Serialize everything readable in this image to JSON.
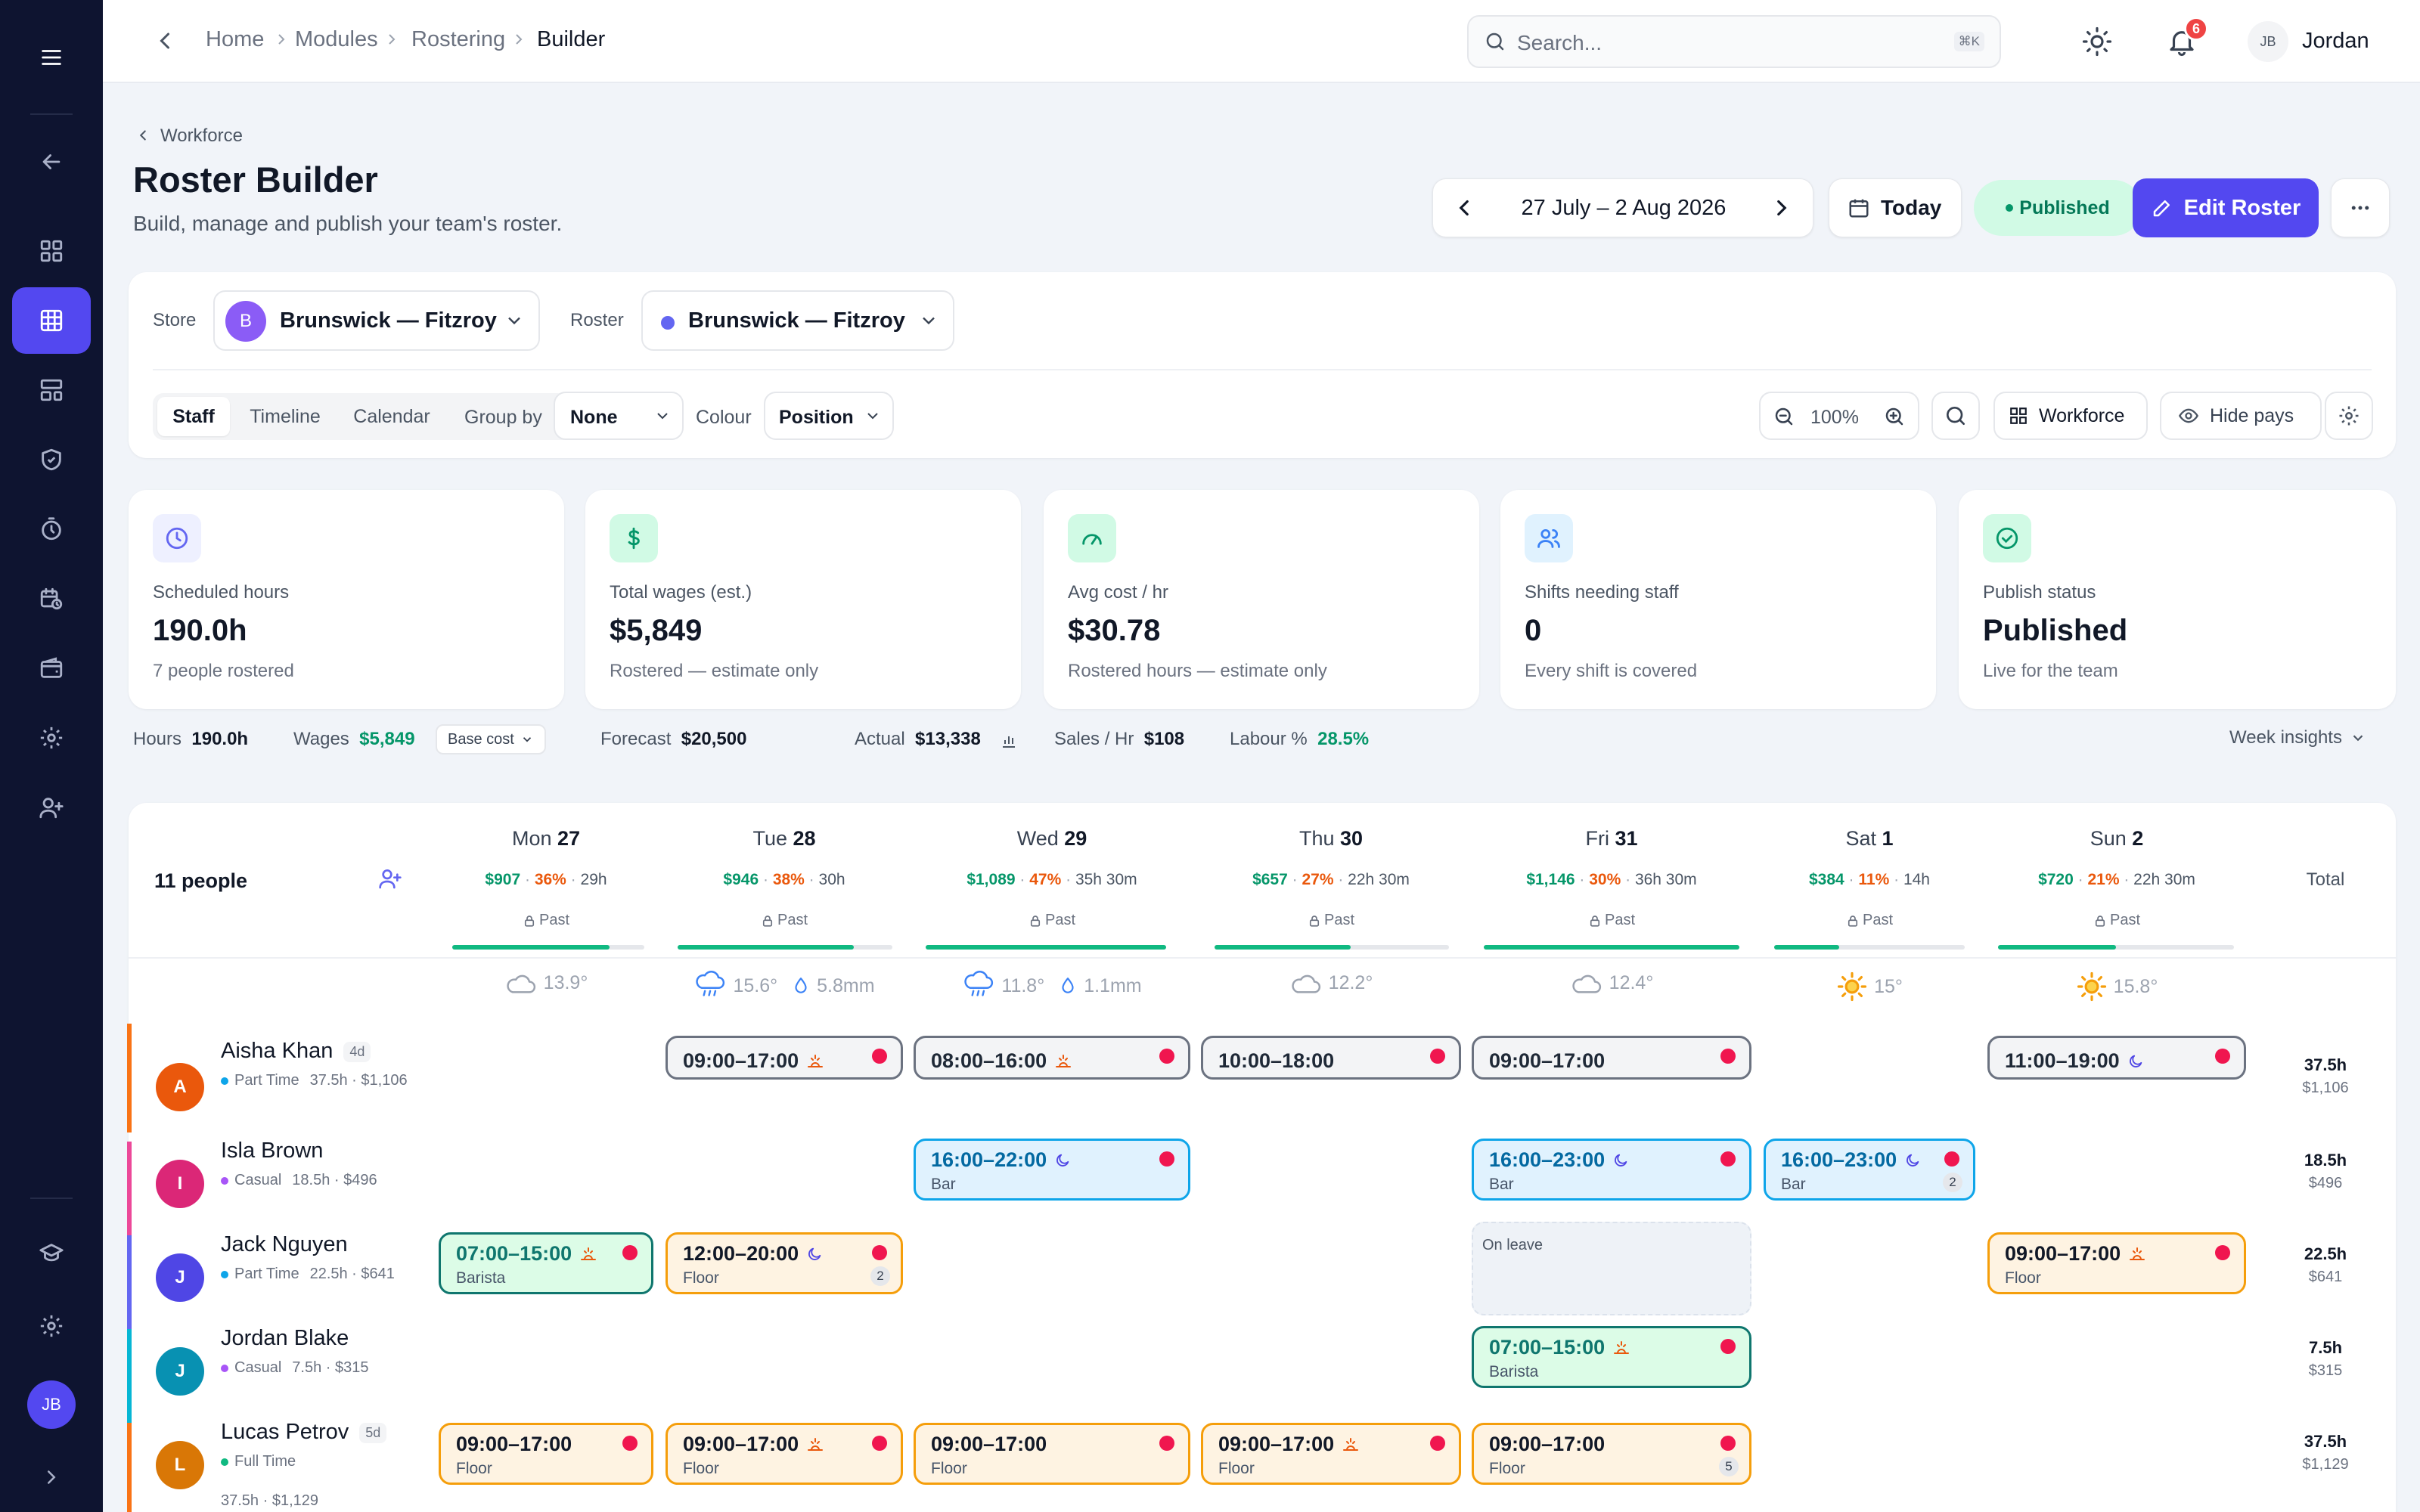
{
  "topbar": {
    "crumbs": [
      "Home",
      "Modules",
      "Rostering",
      "Builder"
    ],
    "search_placeholder": "Search...",
    "search_kbd": "⌘K",
    "notif_count": "6",
    "user_initials": "JB",
    "user_name": "Jordan"
  },
  "sidebar": {
    "user_initials": "JB",
    "icons": [
      "menu-icon",
      "back-arrow-icon",
      "dashboard-icon",
      "roster-grid-icon",
      "layout-icon",
      "shield-icon",
      "timer-icon",
      "calendar-clock-icon",
      "wallet-icon",
      "gear-icon",
      "user-plus-icon",
      "graduation-cap-icon",
      "gear-icon",
      "chevron-right-icon"
    ]
  },
  "header": {
    "back_label": "Workforce",
    "title": "Roster Builder",
    "subtitle": "Build, manage and publish your team's roster.",
    "date_range": "27 July – 2 Aug 2026",
    "today": "Today",
    "status": "Published",
    "edit": "Edit Roster"
  },
  "filters": {
    "store_label": "Store",
    "store_initial": "B",
    "store_name": "Brunswick — Fitzroy",
    "roster_label": "Roster",
    "roster_name": "Brunswick — Fitzroy",
    "views": [
      "Staff",
      "Timeline",
      "Calendar"
    ],
    "group_label": "Group by",
    "group_value": "None",
    "colour_label": "Colour",
    "colour_value": "Position",
    "zoom": "100%",
    "workforce": "Workforce",
    "hide_pays": "Hide pays"
  },
  "stats": [
    {
      "label": "Scheduled hours",
      "value": "190.0h",
      "sub": "7 people rostered",
      "color": "#6366f1",
      "bg": "#eef0ff"
    },
    {
      "label": "Total wages (est.)",
      "value": "$5,849",
      "sub": "Rostered — estimate only",
      "color": "#059669",
      "bg": "#d1fae5"
    },
    {
      "label": "Avg cost / hr",
      "value": "$30.78",
      "sub": "Rostered hours — estimate only",
      "color": "#059669",
      "bg": "#d1fae5"
    },
    {
      "label": "Shifts needing staff",
      "value": "0",
      "sub": "Every shift is covered",
      "color": "#3b82f6",
      "bg": "#e0f2fe"
    },
    {
      "label": "Publish status",
      "value": "Published",
      "sub": "Live for the team",
      "color": "#059669",
      "bg": "#d1fae5"
    }
  ],
  "insights": {
    "hours_label": "Hours",
    "hours": "190.0h",
    "wages_label": "Wages",
    "wages": "$5,849",
    "base_cost": "Base cost",
    "forecast_label": "Forecast",
    "forecast": "$20,500",
    "actual_label": "Actual",
    "actual": "$13,338",
    "sales_label": "Sales / Hr",
    "sales": "$108",
    "labour_label": "Labour %",
    "labour": "28.5%",
    "week": "Week insights"
  },
  "grid": {
    "people": "11 people",
    "total_label": "Total",
    "past_label": "Past",
    "days": [
      {
        "dow": "Mon",
        "date": "27",
        "cost": "$907",
        "pct": "36%",
        "hrs": "29h",
        "progress": 0.82,
        "weather": "cloud",
        "temp": "13.9°",
        "rain": ""
      },
      {
        "dow": "Tue",
        "date": "28",
        "cost": "$946",
        "pct": "38%",
        "hrs": "30h",
        "progress": 0.82,
        "weather": "rain",
        "temp": "15.6°",
        "rain": "5.8mm"
      },
      {
        "dow": "Wed",
        "date": "29",
        "cost": "$1,089",
        "pct": "47%",
        "hrs": "35h 30m",
        "progress": 1.0,
        "weather": "rain",
        "temp": "11.8°",
        "rain": "1.1mm"
      },
      {
        "dow": "Thu",
        "date": "30",
        "cost": "$657",
        "pct": "27%",
        "hrs": "22h 30m",
        "progress": 0.58,
        "weather": "cloud",
        "temp": "12.2°",
        "rain": ""
      },
      {
        "dow": "Fri",
        "date": "31",
        "cost": "$1,146",
        "pct": "30%",
        "hrs": "36h 30m",
        "progress": 1.0,
        "weather": "cloud",
        "temp": "12.4°",
        "rain": ""
      },
      {
        "dow": "Sat",
        "date": "1",
        "cost": "$384",
        "pct": "11%",
        "hrs": "14h",
        "progress": 0.34,
        "weather": "sun",
        "temp": "15°",
        "rain": ""
      },
      {
        "dow": "Sun",
        "date": "2",
        "cost": "$720",
        "pct": "21%",
        "hrs": "22h 30m",
        "progress": 0.5,
        "weather": "sun",
        "temp": "15.8°",
        "rain": ""
      }
    ],
    "employees": [
      {
        "initial": "A",
        "name": "Aisha Khan",
        "tag": "4d",
        "type": "Part Time",
        "typecolor": "#0ea5e9",
        "meta1": "37.5h · $1,106",
        "meta2": "",
        "avatar": "#ea580c",
        "bar": "#f97316",
        "total": "37.5h",
        "total_sub": "$1,106",
        "shifts": [
          {
            "day": 1,
            "time": "09:00–17:00",
            "role": "",
            "style": "grey",
            "icon": "sun",
            "count": ""
          },
          {
            "day": 2,
            "time": "08:00–16:00",
            "role": "",
            "style": "grey",
            "icon": "sun",
            "count": ""
          },
          {
            "day": 3,
            "time": "10:00–18:00",
            "role": "",
            "style": "grey",
            "icon": "",
            "count": ""
          },
          {
            "day": 4,
            "time": "09:00–17:00",
            "role": "",
            "style": "grey",
            "icon": "",
            "count": ""
          },
          {
            "day": 6,
            "time": "11:00–19:00",
            "role": "",
            "style": "grey",
            "icon": "moon",
            "count": ""
          }
        ]
      },
      {
        "initial": "I",
        "name": "Isla Brown",
        "tag": "",
        "type": "Casual",
        "typecolor": "#a855f7",
        "meta1": "18.5h · $496",
        "meta2": "",
        "avatar": "#db2777",
        "bar": "#ec4899",
        "total": "18.5h",
        "total_sub": "$496",
        "shifts": [
          {
            "day": 2,
            "time": "16:00–22:00",
            "role": "Bar",
            "style": "blue",
            "icon": "moon",
            "count": ""
          },
          {
            "day": 4,
            "time": "16:00–23:00",
            "role": "Bar",
            "style": "blue",
            "icon": "moon",
            "count": ""
          },
          {
            "day": 5,
            "time": "16:00–23:00",
            "role": "Bar",
            "style": "blue",
            "icon": "moon",
            "count": "2"
          }
        ]
      },
      {
        "initial": "J",
        "name": "Jack Nguyen",
        "tag": "",
        "type": "Part Time",
        "typecolor": "#0ea5e9",
        "meta1": "22.5h · $641",
        "meta2": "",
        "avatar": "#4f46e5",
        "bar": "#6366f1",
        "total": "22.5h",
        "total_sub": "$641",
        "leave": "On leave",
        "shifts": [
          {
            "day": 0,
            "time": "07:00–15:00",
            "role": "Barista",
            "style": "teal",
            "icon": "sun",
            "count": ""
          },
          {
            "day": 1,
            "time": "12:00–20:00",
            "role": "Floor",
            "style": "orange",
            "icon": "moon",
            "count": "2"
          },
          {
            "day": 6,
            "time": "09:00–17:00",
            "role": "Floor",
            "style": "orange",
            "icon": "sun",
            "count": ""
          }
        ]
      },
      {
        "initial": "J",
        "name": "Jordan Blake",
        "tag": "",
        "type": "Casual",
        "typecolor": "#a855f7",
        "meta1": "7.5h · $315",
        "meta2": "",
        "avatar": "#0891b2",
        "bar": "#06b6d4",
        "total": "7.5h",
        "total_sub": "$315",
        "shifts": [
          {
            "day": 4,
            "time": "07:00–15:00",
            "role": "Barista",
            "style": "teal",
            "icon": "sun",
            "count": ""
          }
        ]
      },
      {
        "initial": "L",
        "name": "Lucas Petrov",
        "tag": "5d",
        "type": "Full Time",
        "typecolor": "#10b981",
        "meta1": "",
        "meta2": "37.5h · $1,129",
        "avatar": "#d97706",
        "bar": "#f97316",
        "total": "37.5h",
        "total_sub": "$1,129",
        "shifts": [
          {
            "day": 0,
            "time": "09:00–17:00",
            "role": "Floor",
            "style": "orange",
            "icon": "",
            "count": ""
          },
          {
            "day": 1,
            "time": "09:00–17:00",
            "role": "Floor",
            "style": "orange",
            "icon": "sun",
            "count": ""
          },
          {
            "day": 2,
            "time": "09:00–17:00",
            "role": "Floor",
            "style": "orange",
            "icon": "",
            "count": ""
          },
          {
            "day": 3,
            "time": "09:00–17:00",
            "role": "Floor",
            "style": "orange",
            "icon": "sun",
            "count": ""
          },
          {
            "day": 4,
            "time": "09:00–17:00",
            "role": "Floor",
            "style": "orange",
            "icon": "",
            "count": "5"
          }
        ]
      }
    ]
  }
}
